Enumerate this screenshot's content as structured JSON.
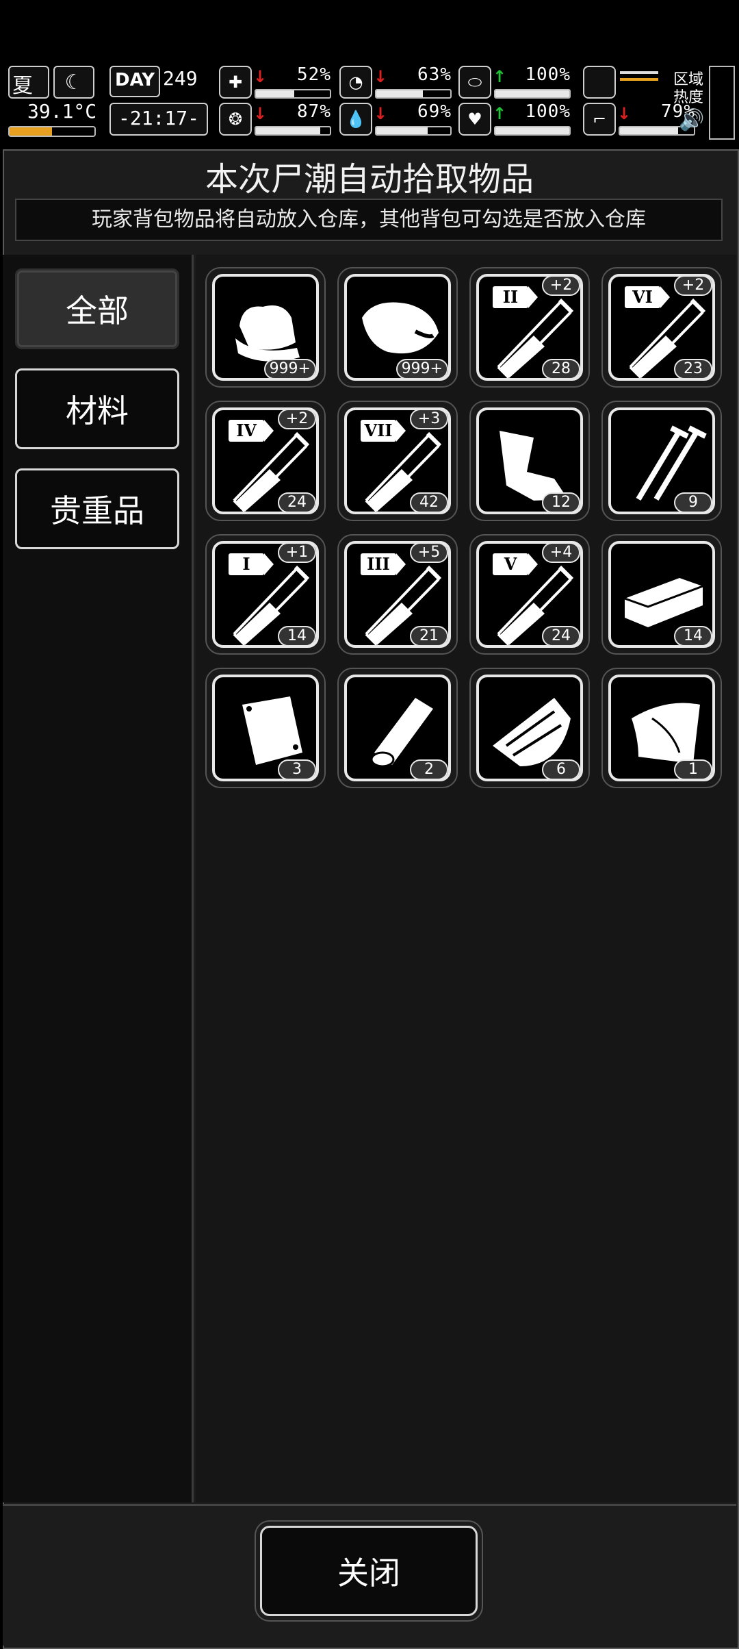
{
  "hud": {
    "season": "夏",
    "temperature": "39.1°C",
    "day_label": "DAY",
    "day_number": "249",
    "clock": "-21:17-",
    "zone_heat_label": "区域\n热度",
    "stats": [
      {
        "name": "health",
        "icon": "medkit-icon",
        "trend": "down",
        "value": "52%",
        "level": 0.52
      },
      {
        "name": "stomach",
        "icon": "stomach-icon",
        "trend": "down",
        "value": "63%",
        "level": 0.63
      },
      {
        "name": "pill",
        "icon": "pill-icon",
        "trend": "up",
        "value": "100%",
        "level": 1.0
      },
      {
        "name": "brain",
        "icon": "brain-icon",
        "trend": "down",
        "value": "87%",
        "level": 0.87
      },
      {
        "name": "water",
        "icon": "water-drop-icon",
        "trend": "down",
        "value": "69%",
        "level": 0.69
      },
      {
        "name": "heart",
        "icon": "heart-icon",
        "trend": "up",
        "value": "100%",
        "level": 1.0
      },
      {
        "name": "stamina",
        "icon": "foot-icon",
        "trend": "down",
        "value": "79%",
        "level": 0.79
      }
    ]
  },
  "dialog": {
    "title": "本次尸潮自动拾取物品",
    "subtitle": "玩家背包物品将自动放入仓库，其他背包可勾选是否放入仓库"
  },
  "tabs": [
    {
      "label": "全部",
      "active": true
    },
    {
      "label": "材料",
      "active": false
    },
    {
      "label": "贵重品",
      "active": false
    }
  ],
  "items": [
    {
      "icon": "cloth-icon",
      "count": "999+"
    },
    {
      "icon": "meat-icon",
      "count": "999+"
    },
    {
      "icon": "syringe-icon",
      "roman": "II",
      "bonus": "+2",
      "count": "28"
    },
    {
      "icon": "syringe-icon",
      "roman": "VI",
      "bonus": "+2",
      "count": "23"
    },
    {
      "icon": "syringe-icon",
      "roman": "IV",
      "bonus": "+2",
      "count": "24"
    },
    {
      "icon": "syringe-icon",
      "roman": "VII",
      "bonus": "+3",
      "count": "42"
    },
    {
      "icon": "scrap-metal-icon",
      "count": "12"
    },
    {
      "icon": "nails-icon",
      "count": "9"
    },
    {
      "icon": "syringe-icon",
      "roman": "I",
      "bonus": "+1",
      "count": "14"
    },
    {
      "icon": "syringe-icon",
      "roman": "III",
      "bonus": "+5",
      "count": "21"
    },
    {
      "icon": "syringe-icon",
      "roman": "V",
      "bonus": "+4",
      "count": "24"
    },
    {
      "icon": "brick-icon",
      "count": "14"
    },
    {
      "icon": "bag-icon",
      "count": "3"
    },
    {
      "icon": "wood-log-icon",
      "count": "2"
    },
    {
      "icon": "wood-planks-icon",
      "count": "6"
    },
    {
      "icon": "leather-icon",
      "count": "1"
    }
  ],
  "footer": {
    "close_label": "关闭"
  },
  "colors": {
    "up": "#22c33a",
    "down": "#e02020",
    "temp_bar": "#e8a020"
  }
}
